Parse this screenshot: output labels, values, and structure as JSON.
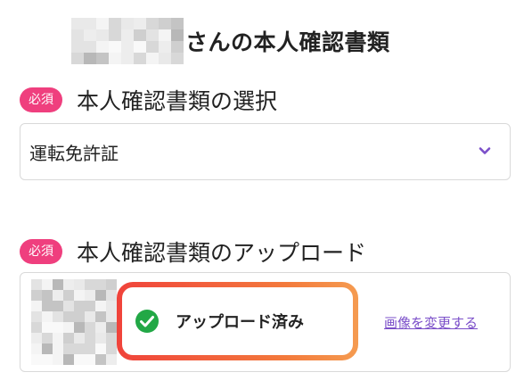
{
  "title": {
    "name_mosaic": "pixelated name",
    "suffix": "さんの本人確認書類"
  },
  "section_select": {
    "badge": "必須",
    "label": "本人確認書類の選択"
  },
  "document_select": {
    "value": "運転免許証",
    "icon": "chevron-down-icon"
  },
  "section_upload": {
    "badge": "必須",
    "label": "本人確認書類のアップロード"
  },
  "upload": {
    "thumbnail": "pixelated document image",
    "status_text": "アップロード済み",
    "status_icon": "check-circle-icon",
    "change_link": "画像を変更する"
  },
  "colors": {
    "badge": "#ef3f7e",
    "accent": "#7b4fc9",
    "check": "#22a846",
    "frame_start": "#f0433b",
    "frame_end": "#f59b50"
  }
}
